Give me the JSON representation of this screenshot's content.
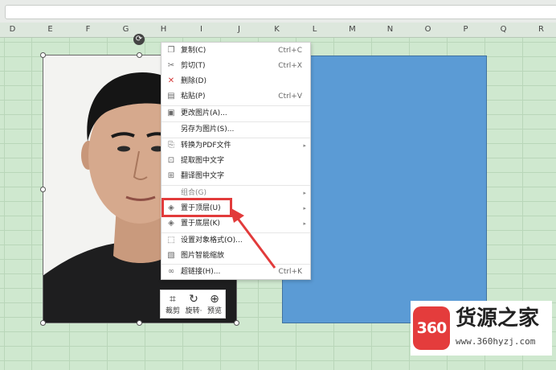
{
  "columns": [
    "D",
    "E",
    "F",
    "G",
    "H",
    "I",
    "J",
    "K",
    "L",
    "M",
    "N",
    "O",
    "P",
    "Q",
    "R"
  ],
  "context_menu": {
    "items": [
      {
        "label": "复制(C)",
        "shortcut": "Ctrl+C",
        "icon": "copy-icon"
      },
      {
        "label": "剪切(T)",
        "shortcut": "Ctrl+X",
        "icon": "scissors-icon"
      },
      {
        "label": "删除(D)",
        "shortcut": "",
        "icon": "delete-x-icon"
      },
      {
        "label": "粘贴(P)",
        "shortcut": "Ctrl+V",
        "icon": "paste-icon"
      },
      {
        "label": "更改图片(A)...",
        "shortcut": "",
        "icon": "change-image-icon"
      },
      {
        "label": "另存为图片(S)...",
        "shortcut": "",
        "icon": ""
      },
      {
        "label": "转换为PDF文件",
        "shortcut": "",
        "icon": "pdf-icon",
        "submenu": true
      },
      {
        "label": "提取图中文字",
        "shortcut": "",
        "icon": "extract-text-icon"
      },
      {
        "label": "翻译图中文字",
        "shortcut": "",
        "icon": "translate-icon"
      },
      {
        "label": "组合(G)",
        "shortcut": "",
        "icon": "",
        "submenu": true
      },
      {
        "label": "置于顶层(U)",
        "shortcut": "",
        "icon": "bring-to-front-icon",
        "submenu": true
      },
      {
        "label": "置于底层(K)",
        "shortcut": "",
        "icon": "send-to-back-icon",
        "submenu": true
      },
      {
        "label": "设置对象格式(O)...",
        "shortcut": "",
        "icon": "format-object-icon"
      },
      {
        "label": "图片智能缩放",
        "shortcut": "",
        "icon": "smart-scale-icon"
      },
      {
        "label": "超链接(H)...",
        "shortcut": "Ctrl+K",
        "icon": "link-icon"
      }
    ]
  },
  "float_toolbar": {
    "crop": "裁剪",
    "rotate": "旋转·",
    "preview": "预览"
  },
  "watermark": {
    "badge": "360",
    "title": "货源之家",
    "url": "www.360hyzj.com"
  },
  "colors": {
    "sheet_bg": "#cfe8cf",
    "shape_fill": "#5b9bd5",
    "highlight": "#e23b3b",
    "logo_red": "#e43c3c"
  }
}
